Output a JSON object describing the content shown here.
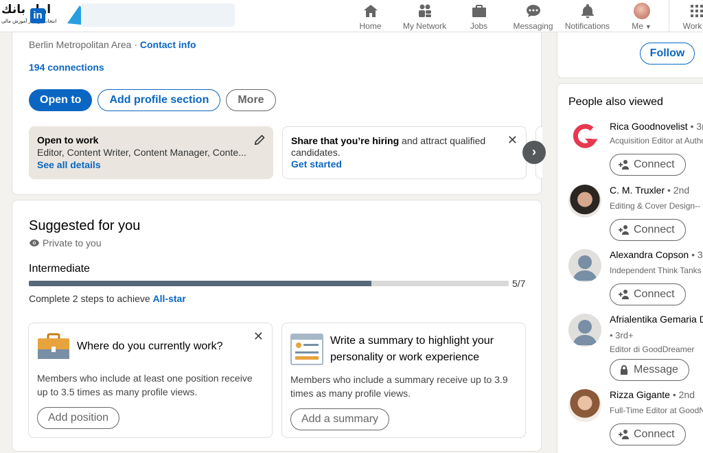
{
  "watermark": {
    "logo_text": "اول بانك",
    "logo_sub": "انتخاب اول در آموزش مالی"
  },
  "nav": {
    "items": [
      {
        "label": "Home",
        "icon": "home-icon"
      },
      {
        "label": "My Network",
        "icon": "network-icon"
      },
      {
        "label": "Jobs",
        "icon": "briefcase-icon"
      },
      {
        "label": "Messaging",
        "icon": "chat-icon"
      },
      {
        "label": "Notifications",
        "icon": "bell-icon"
      },
      {
        "label": "Me",
        "icon": "avatar"
      },
      {
        "label": "Work",
        "icon": "grid-icon"
      }
    ]
  },
  "profile": {
    "location": "Berlin Metropolitan Area",
    "separator": "·",
    "contact_info": "Contact info",
    "connections": "194 connections",
    "buttons": {
      "open_to": "Open to",
      "add_section": "Add profile section",
      "more": "More"
    },
    "open_to_work": {
      "title": "Open to work",
      "roles": "Editor, Content Writer, Content Manager, Conte...",
      "link": "See all details"
    },
    "hiring": {
      "bold": "Share that you’re hiring",
      "rest": " and attract qualified candidates.",
      "link": "Get started"
    }
  },
  "suggested": {
    "title": "Suggested for you",
    "private": "Private to you",
    "level": "Intermediate",
    "progress_fraction": 0.714,
    "progress_count": "5/7",
    "complete_prefix": "Complete 2 steps to achieve ",
    "complete_link": "All-star",
    "tasks": [
      {
        "title": "Where do you currently work?",
        "desc": "Members who include at least one position receive up to 3.5 times as many profile views.",
        "button": "Add position"
      },
      {
        "title": "Write a summary to highlight your personality or work experience",
        "desc": "Members who include a summary receive up to 3.9 times as many profile views.",
        "button": "Add a summary"
      }
    ]
  },
  "right": {
    "follow": "Follow",
    "people_title": "People also viewed",
    "people": [
      {
        "name": "Rica Goodnovelist",
        "degree": " • 3r",
        "line1": "Acquisition Editor at Autho",
        "line2": "",
        "button": "Connect"
      },
      {
        "name": "C. M. Truxler",
        "degree": " • 2nd",
        "line1": "Editing & Cover Design-- f",
        "line2": "",
        "button": "Connect"
      },
      {
        "name": "Alexandra Copson",
        "degree": " • 3",
        "line1": "Independent Think Tanks R",
        "line2": "",
        "button": "Connect"
      },
      {
        "name": "Afrialentika Gemaria D",
        "degree": "",
        "line1": "• 3rd+",
        "line2": "Editor di GoodDreamer",
        "button": "Message"
      },
      {
        "name": "Rizza Gigante",
        "degree": " • 2nd",
        "line1": "Full-Time Editor at GoodN",
        "line2": "",
        "button": "Connect"
      }
    ]
  }
}
